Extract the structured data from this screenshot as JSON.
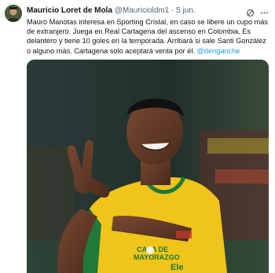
{
  "tweet": {
    "author_name": "Mauricio Loret de Mola",
    "author_handle": "@Mauricioldm1",
    "separator": "·",
    "date": "5 jun.",
    "text_1": "Mauro Manotas interesa en Sporting Cristal, en caso se libere un cupo más de extranjero. Juega en Real Cartagena del ascenso en Colombia. Es delantero y tiene 10 goles en la temporada. Arribará si sale Santi González o alguno más. Cartagena solo aceptará venta por él. ",
    "mention": "@denganche",
    "media": {
      "description_icon": "photo",
      "jersey_texts": [
        "CASA DE",
        "MAYORAZGO",
        "Ele"
      ]
    }
  },
  "icons": {
    "avatar": "user-avatar",
    "grok": "grok-icon",
    "more": "more-icon"
  },
  "colors": {
    "link": "#1d9bf0",
    "secondary_text": "#536471",
    "jersey": "#f0c419"
  }
}
